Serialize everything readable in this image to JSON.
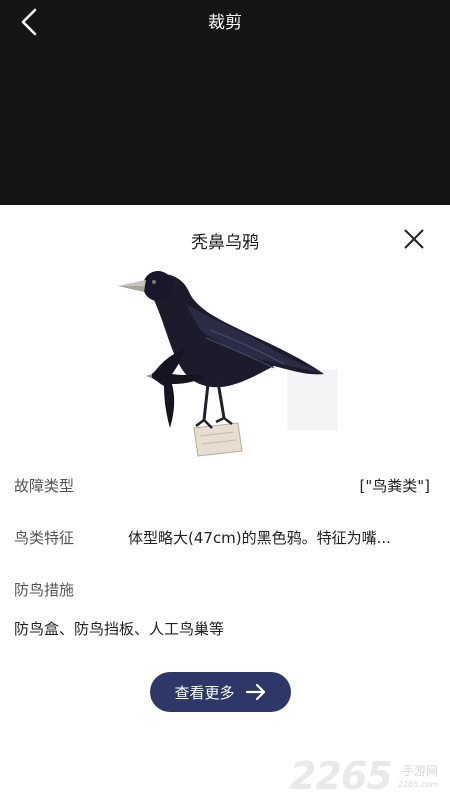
{
  "header": {
    "title": "裁剪",
    "back_icon": "chevron-left-icon"
  },
  "sheet": {
    "title": "秃鼻乌鸦",
    "close_icon": "close-icon"
  },
  "details": {
    "fault_type_label": "故障类型",
    "fault_type_value": "[\"鸟粪类\"]",
    "features_label": "鸟类特征",
    "features_value": "体型略大(47cm)的黑色鸦。特征为嘴...",
    "measures_label": "防鸟措施",
    "measures_value": "防鸟盒、防鸟挡板、人工鸟巢等"
  },
  "more_button": {
    "label": "查看更多",
    "icon": "arrow-right-icon"
  },
  "watermark": {
    "number": "2265",
    "text": "手游网",
    "url": "2265.com"
  },
  "colors": {
    "topbar": "#151515",
    "button": "#2d3768"
  }
}
